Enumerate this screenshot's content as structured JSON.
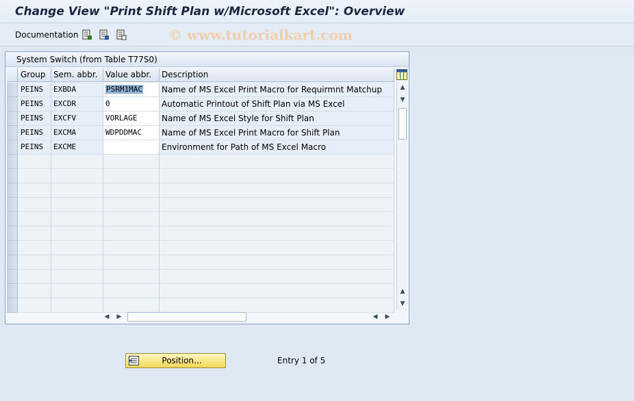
{
  "window": {
    "title": "Change View \"Print Shift Plan w/Microsoft Excel\": Overview"
  },
  "toolbar": {
    "documentation_label": "Documentation",
    "watermark": "© www.tutorialkart.com"
  },
  "panel": {
    "title": "System Switch (from Table T77S0)"
  },
  "table": {
    "columns": [
      "Group",
      "Sem. abbr.",
      "Value abbr.",
      "Description"
    ],
    "rows": [
      {
        "group": "PEINS",
        "sem": "EXBDA",
        "value": "PSRM1MAC",
        "desc": "Name of MS Excel Print Macro for Requirmnt Matchup"
      },
      {
        "group": "PEINS",
        "sem": "EXCDR",
        "value": "0",
        "desc": "Automatic Printout of Shift Plan via MS Excel"
      },
      {
        "group": "PEINS",
        "sem": "EXCFV",
        "value": "VORLAGE",
        "desc": "Name of MS Excel Style for Shift Plan"
      },
      {
        "group": "PEINS",
        "sem": "EXCMA",
        "value": "WDPDDMAC",
        "desc": "Name of MS Excel Print Macro for Shift Plan"
      },
      {
        "group": "PEINS",
        "sem": "EXCME",
        "value": "",
        "desc": "Environment for Path of MS Excel Macro"
      }
    ],
    "empty_rows": 11
  },
  "footer": {
    "position_label": "Position...",
    "entry_text": "Entry 1 of 5"
  },
  "colors": {
    "accent": "#f4d858",
    "selection": "#8fb1d6",
    "background": "#dfe9f3"
  }
}
